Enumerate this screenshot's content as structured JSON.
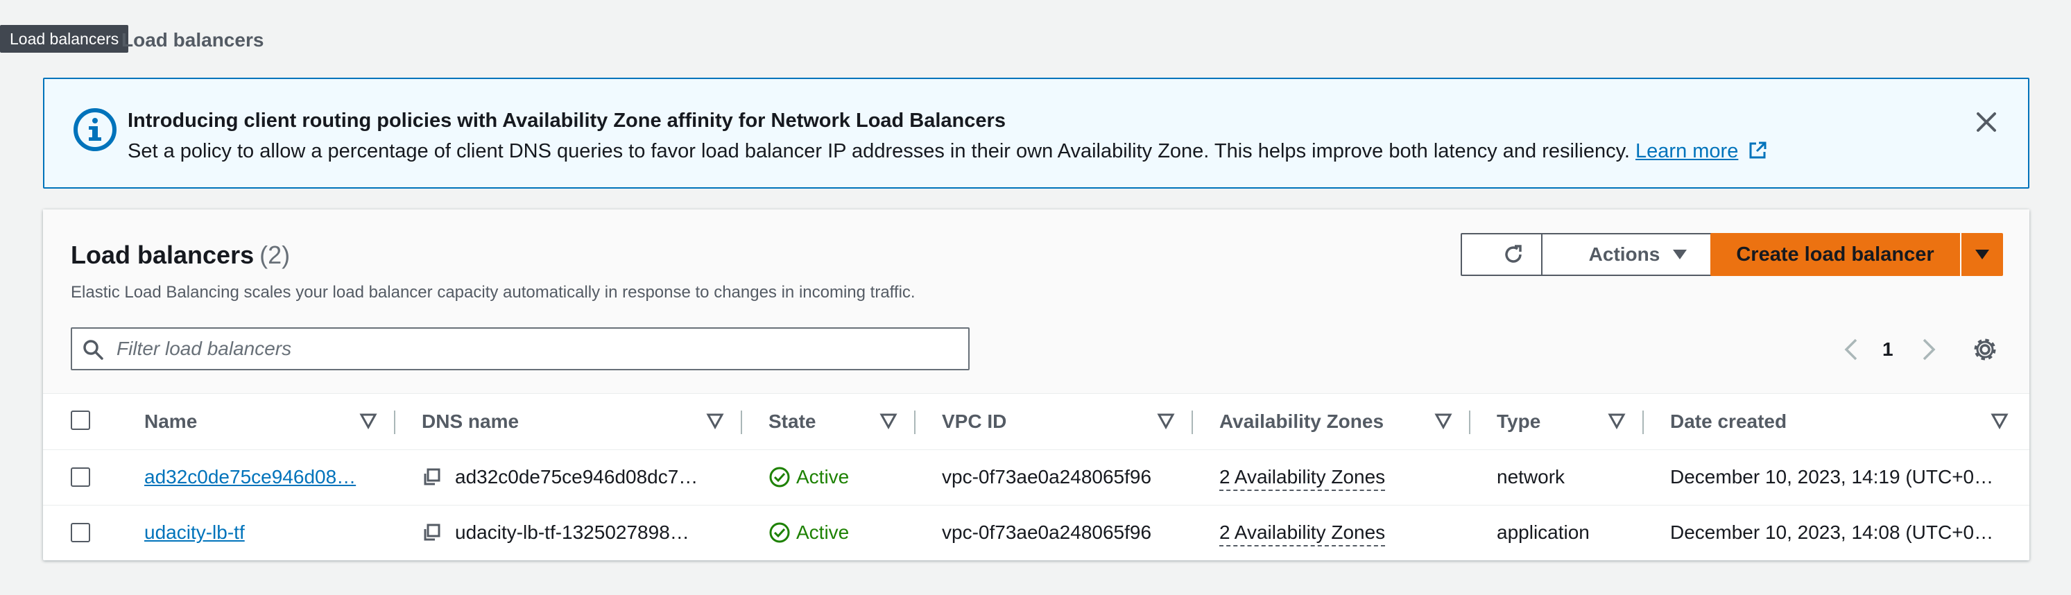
{
  "tooltip": "Load balancers",
  "page_title": "Load balancers",
  "flash": {
    "title": "Introducing client routing policies with Availability Zone affinity for Network Load Balancers",
    "body": "Set a policy to allow a percentage of client DNS queries to favor load balancer IP addresses in their own Availability Zone. This helps improve both latency and resiliency.",
    "link": "Learn more",
    "color_accent": "#0073bb"
  },
  "panel": {
    "title": "Load balancers",
    "count": "(2)",
    "description": "Elastic Load Balancing scales your load balancer capacity automatically in response to changes in incoming traffic.",
    "actions_label": "Actions",
    "create_label": "Create load balancer",
    "primary_color": "#ec7211",
    "filter_placeholder": "Filter load balancers",
    "page_number": "1"
  },
  "table": {
    "columns": [
      "Name",
      "DNS name",
      "State",
      "VPC ID",
      "Availability Zones",
      "Type",
      "Date created"
    ],
    "rows": [
      {
        "name": "ad32c0de75ce946d08…",
        "dns": "ad32c0de75ce946d08dc7…",
        "state": "Active",
        "vpc": "vpc-0f73ae0a248065f96",
        "az": "2 Availability Zones",
        "type": "network",
        "date": "December 10, 2023, 14:19 (UTC+0…"
      },
      {
        "name": "udacity-lb-tf",
        "dns": "udacity-lb-tf-1325027898…",
        "state": "Active",
        "vpc": "vpc-0f73ae0a248065f96",
        "az": "2 Availability Zones",
        "type": "application",
        "date": "December 10, 2023, 14:08 (UTC+0…"
      }
    ]
  }
}
